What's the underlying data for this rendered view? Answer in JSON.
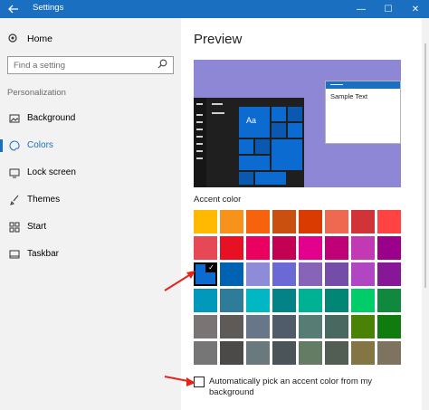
{
  "window": {
    "title": "Settings",
    "back_icon": "back-arrow-icon",
    "min_glyph": "—",
    "max_glyph": "☐",
    "close_glyph": "✕",
    "titlebar_color": "#1a6fc1"
  },
  "sidebar": {
    "home_label": "Home",
    "search_placeholder": "Find a setting",
    "section_label": "Personalization",
    "items": [
      {
        "label": "Background",
        "icon": "picture-icon",
        "selected": false
      },
      {
        "label": "Colors",
        "icon": "palette-icon",
        "selected": true
      },
      {
        "label": "Lock screen",
        "icon": "monitor-icon",
        "selected": false
      },
      {
        "label": "Themes",
        "icon": "brush-icon",
        "selected": false
      },
      {
        "label": "Start",
        "icon": "grid-icon",
        "selected": false
      },
      {
        "label": "Taskbar",
        "icon": "taskbar-icon",
        "selected": false
      }
    ]
  },
  "main": {
    "heading": "Preview",
    "preview_sample_text": "Sample Text",
    "preview_tile_label": "Aa",
    "accent_title": "Accent color",
    "selected_accent": "#0b6bd0",
    "accent_colors": [
      "#ffb900",
      "#f7921a",
      "#f7630c",
      "#ca5010",
      "#da3b01",
      "#ef6950",
      "#d13438",
      "#ff4343",
      "#e74856",
      "#e81123",
      "#ea005e",
      "#c30052",
      "#e3008c",
      "#bf0077",
      "#c239b3",
      "#9a0089",
      "#0b6bd0",
      "#0063b1",
      "#8e8cd8",
      "#6b69d6",
      "#8764b8",
      "#744da9",
      "#b146c2",
      "#881798",
      "#0099bc",
      "#2d7d9a",
      "#00b7c3",
      "#038387",
      "#00b294",
      "#018574",
      "#00cc6a",
      "#10893e",
      "#7a7574",
      "#5d5a58",
      "#68768a",
      "#515c6b",
      "#567c73",
      "#486860",
      "#498205",
      "#107c10",
      "#767676",
      "#4c4a48",
      "#69797e",
      "#4a5459",
      "#647c64",
      "#525e54",
      "#847545",
      "#7e735f"
    ],
    "auto_pick_label": "Automatically pick an accent color from my background",
    "auto_pick_checked": false
  },
  "annotations": {
    "arrow_color": "#e8211d"
  }
}
